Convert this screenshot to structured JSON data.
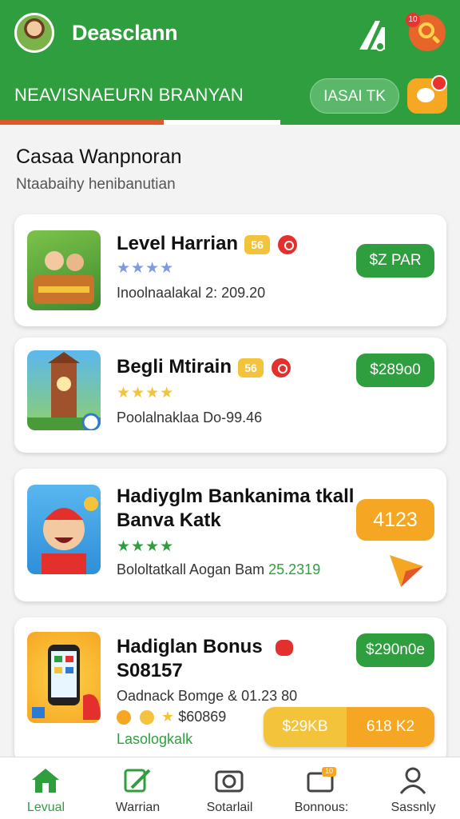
{
  "header": {
    "app_title": "Deasclann",
    "nav_label": "NEAVISNAEURN BRANYAN",
    "tab_pill": "IASAI TK",
    "search_badge": "10"
  },
  "section": {
    "title": "Casaa Wanpnoran",
    "subtitle": "Ntaabaihy henibanutian"
  },
  "cards": [
    {
      "title": "Level Harrian",
      "tag": "56",
      "stars": "★★★★",
      "meta": "Inoolnaalakal 2:  209.20",
      "price": "$Z PAR"
    },
    {
      "title": "Begli Mtirain",
      "tag": "56",
      "stars": "★★★★",
      "meta": "Poolalnaklaa Do-99.46",
      "price": "$289o0"
    },
    {
      "title_line1": "Hadiyglm Bankanima tkall",
      "title_line2": "Banva Katk",
      "stars": "★★★★",
      "meta_prefix": "Bololtatkall Aogan Bam",
      "meta_value": "25.2319",
      "price": "4123"
    },
    {
      "title_line1": "Hadiglan  Bonus",
      "title_line2": "S08157",
      "meta": "Oadnack Bomge  & 01.23  80",
      "meta2": "$60869",
      "link": "Lasologkalk",
      "price": "$290n0e",
      "promo_left": "$29KB",
      "promo_right": "618 K2"
    }
  ],
  "bottom_nav": [
    {
      "label": "Levual",
      "icon": "home-icon",
      "active": true
    },
    {
      "label": "Warrian",
      "icon": "edit-icon",
      "active": false
    },
    {
      "label": "Sotarlail",
      "icon": "camera-icon",
      "active": false
    },
    {
      "label": "Bonnous:",
      "icon": "monitor-icon",
      "active": false
    },
    {
      "label": "Sassnly",
      "icon": "user-icon",
      "active": false
    }
  ],
  "bonus_badge": "10",
  "colors": {
    "primary_green": "#2e9e3e",
    "accent_orange": "#f5a623",
    "alert_red": "#e3302c",
    "tab_underline": "#e2572a"
  }
}
